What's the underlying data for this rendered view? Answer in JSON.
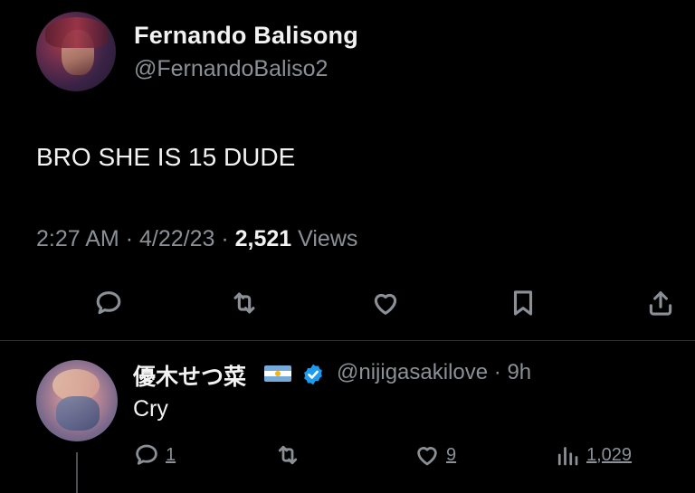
{
  "tweet": {
    "author": {
      "display_name": "Fernando Balisong",
      "handle": "@FernandoBaliso2",
      "avatar": "anime-avatar"
    },
    "text": "BRO SHE IS 15 DUDE",
    "time": "2:27 AM",
    "date": "4/22/23",
    "views_count": "2,521",
    "views_label": "Views",
    "actions": [
      "reply-icon",
      "retweet-icon",
      "like-icon",
      "bookmark-icon",
      "share-icon"
    ]
  },
  "reply": {
    "author": {
      "display_name": "優木せつ菜",
      "flag": "argentina-flag",
      "verified": true,
      "handle": "@nijigasakilove",
      "age": "9h"
    },
    "text": "Cry",
    "reply_count": "1",
    "like_count": "9",
    "view_count": "1,029",
    "separator": "·"
  },
  "colors": {
    "background": "#000000",
    "text": "#e7e9ea",
    "muted": "#8b9096",
    "verified": "#1d9bf0"
  }
}
